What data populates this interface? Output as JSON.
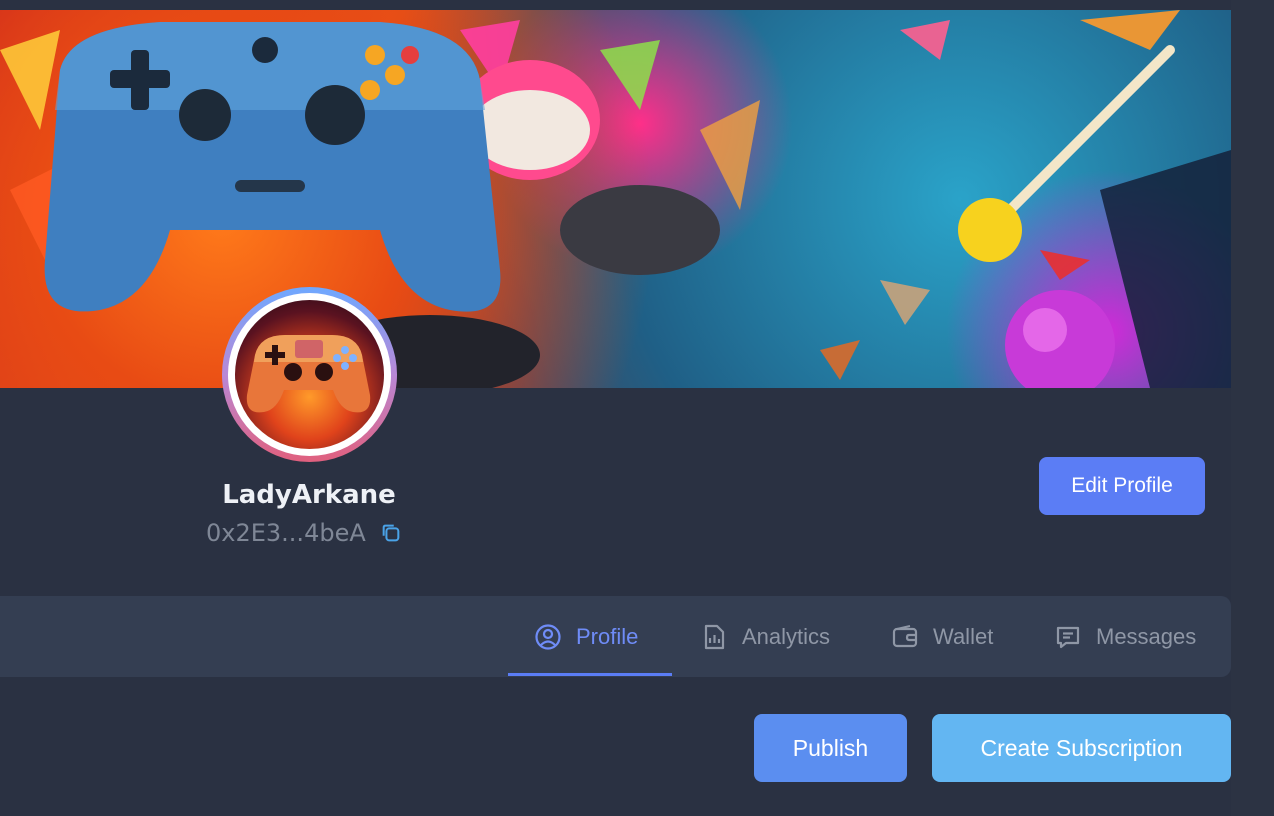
{
  "profile": {
    "username": "LadyArkane",
    "address": "0x2E3...4beA",
    "edit_label": "Edit Profile"
  },
  "tabs": [
    {
      "label": "Profile",
      "icon": "user-circle-icon",
      "active": true
    },
    {
      "label": "Analytics",
      "icon": "report-icon",
      "active": false
    },
    {
      "label": "Wallet",
      "icon": "wallet-icon",
      "active": false
    },
    {
      "label": "Messages",
      "icon": "message-icon",
      "active": false
    }
  ],
  "actions": {
    "publish_label": "Publish",
    "subscription_label": "Create Subscription"
  },
  "colors": {
    "background": "#2a3142",
    "accent": "#5b7df5",
    "tab_bar": "#343e52",
    "secondary_button": "#63b6f2"
  }
}
